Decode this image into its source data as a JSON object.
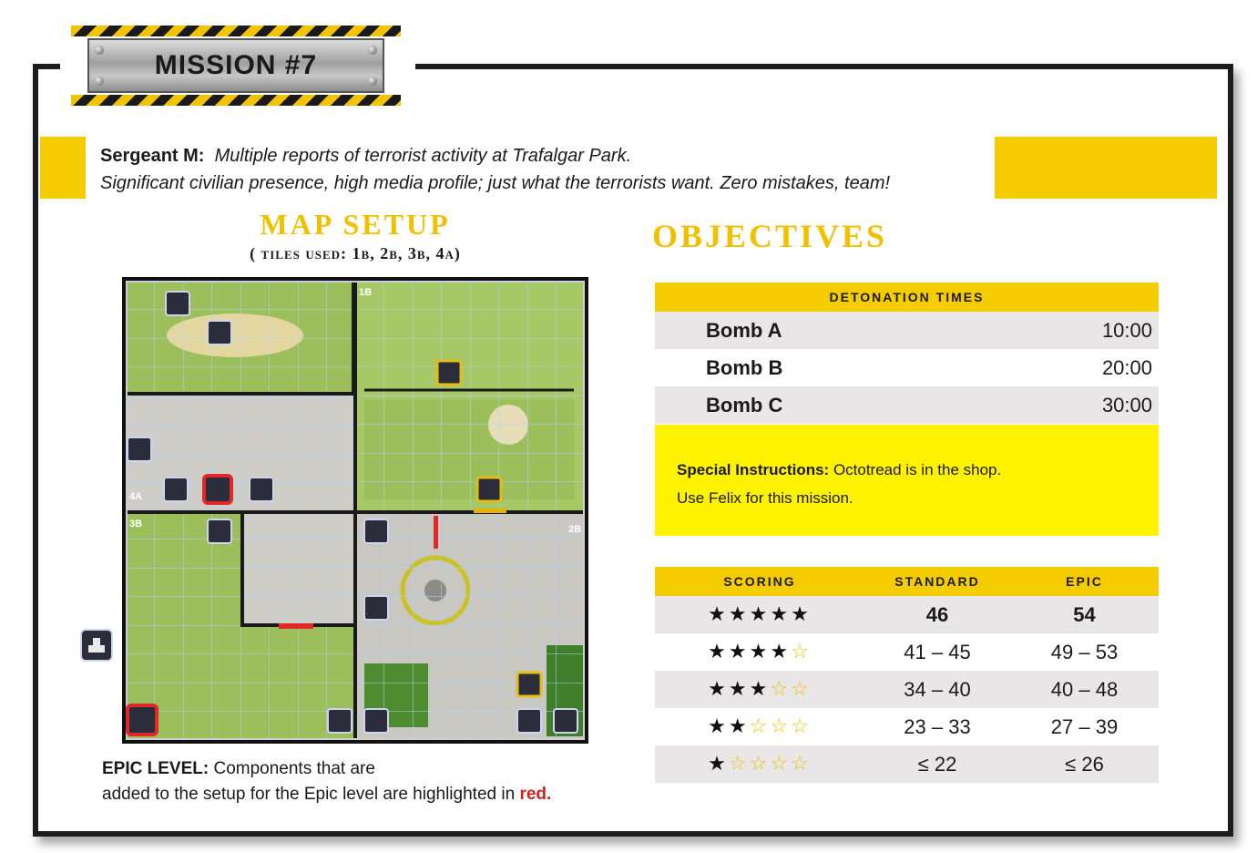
{
  "mission": {
    "title": "MISSION #7"
  },
  "briefing": {
    "speaker": "Sergeant M:",
    "line1": "Multiple reports of terrorist activity at Trafalgar Park.",
    "line2": "Significant civilian presence, high media profile; just what the terrorists want. Zero mistakes, team!"
  },
  "map_setup": {
    "title": "MAP SETUP",
    "tiles_used": "( tiles used: 1b, 2b, 3b, 4a)",
    "tile_labels": [
      "1B",
      "2B",
      "3B",
      "4A"
    ]
  },
  "epic_note": {
    "label": "EPIC LEVEL:",
    "text1": "Components that are",
    "text2": "added to the setup for the Epic level are highlighted in",
    "red_word": "red."
  },
  "objectives": {
    "title": "OBJECTIVES",
    "detonation_header": "DETONATION TIMES",
    "bombs": [
      {
        "name": "Bomb A",
        "time": "10:00"
      },
      {
        "name": "Bomb B",
        "time": "20:00"
      },
      {
        "name": "Bomb C",
        "time": "30:00"
      }
    ],
    "special": {
      "label": "Special Instructions:",
      "line1": "Octotread is in the shop.",
      "line2": "Use Felix for this mission."
    }
  },
  "scoring": {
    "headers": {
      "scoring": "SCORING",
      "standard": "STANDARD",
      "epic": "EPIC"
    },
    "rows": [
      {
        "stars": 5,
        "standard": "46",
        "epic": "54"
      },
      {
        "stars": 4,
        "standard": "41 – 45",
        "epic": "49 – 53"
      },
      {
        "stars": 3,
        "standard": "34 – 40",
        "epic": "40 – 48"
      },
      {
        "stars": 2,
        "standard": "23 – 33",
        "epic": "27 – 39"
      },
      {
        "stars": 1,
        "standard": "≤ 22",
        "epic": "≤ 26"
      }
    ]
  },
  "colors": {
    "accent_yellow": "#f5cc00",
    "special_yellow": "#fff200",
    "epic_red": "#d21f1f",
    "row_grey": "#e8e6e6"
  }
}
